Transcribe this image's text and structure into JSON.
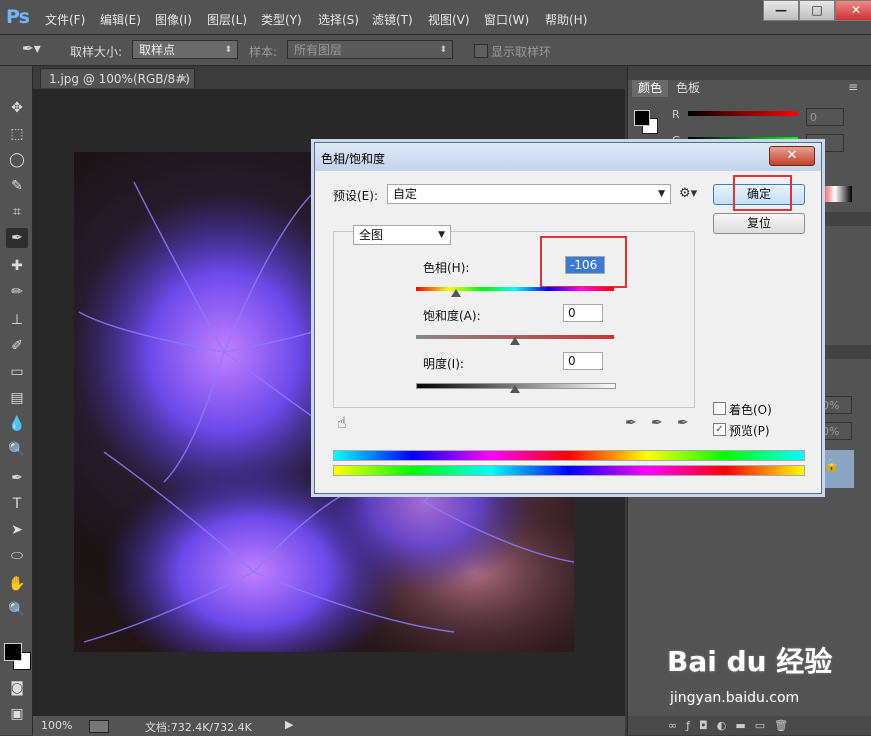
{
  "app": {
    "logo": "Ps"
  },
  "menus": [
    "文件(F)",
    "编辑(E)",
    "图像(I)",
    "图层(L)",
    "类型(Y)",
    "选择(S)",
    "滤镜(T)",
    "视图(V)",
    "窗口(W)",
    "帮助(H)"
  ],
  "window_buttons": {
    "minimize": "—",
    "maximize": "□",
    "close": "✕"
  },
  "options": {
    "sample_size_label": "取样大小:",
    "sample_size_value": "取样点",
    "sample_label": "样本:",
    "sample_value": "所有图层",
    "show_ring_label": "显示取样环"
  },
  "tools": [
    "move-tool",
    "marquee-tool",
    "lasso-tool",
    "quick-select-tool",
    "crop-tool",
    "eyedropper-tool",
    "healing-tool",
    "brush-tool",
    "stamp-tool",
    "history-brush-tool",
    "eraser-tool",
    "gradient-tool",
    "blur-tool",
    "dodge-tool",
    "pen-tool",
    "type-tool",
    "path-select-tool",
    "ellipse-tool",
    "hand-tool",
    "zoom-tool"
  ],
  "tool_glyphs": [
    "✥",
    "⬚",
    "◯",
    "✎",
    "⌗",
    "✒",
    "✚",
    "✏",
    "⊥",
    "✐",
    "▭",
    "▤",
    "💧",
    "🔍",
    "✒",
    "T",
    "➤",
    "⬭",
    "✋",
    "🔍"
  ],
  "document": {
    "tab_title": "1.jpg @ 100%(RGB/8#)",
    "tab_close": "×"
  },
  "status": {
    "zoom": "100%",
    "doc_info": "文档:732.4K/732.4K"
  },
  "panels": {
    "color_tab": "颜色",
    "swatches_tab": "色板",
    "r_label": "R",
    "g_label": "G",
    "r_value": "0",
    "g_value": "0",
    "opacity_1": "0%",
    "opacity_2": "0%"
  },
  "dialog": {
    "title": "色相/饱和度",
    "close": "✕",
    "preset_label": "预设(E):",
    "preset_value": "自定",
    "ok": "确定",
    "reset": "复位",
    "channel_value": "全图",
    "hue_label": "色相(H):",
    "hue_value": "-106",
    "hue_fraction": 0.2,
    "saturation_label": "饱和度(A):",
    "saturation_value": "0",
    "saturation_fraction": 0.5,
    "lightness_label": "明度(I):",
    "lightness_value": "0",
    "lightness_fraction": 0.5,
    "colorize_label": "着色(O)",
    "preview_label": "预览(P)",
    "preview_checked": "✓"
  },
  "watermark": {
    "brand": "Bai du 经验",
    "url": "jingyan.baidu.com"
  },
  "colors": {
    "highlight": "#e0323a",
    "ps_blue": "#6fb6ff"
  }
}
